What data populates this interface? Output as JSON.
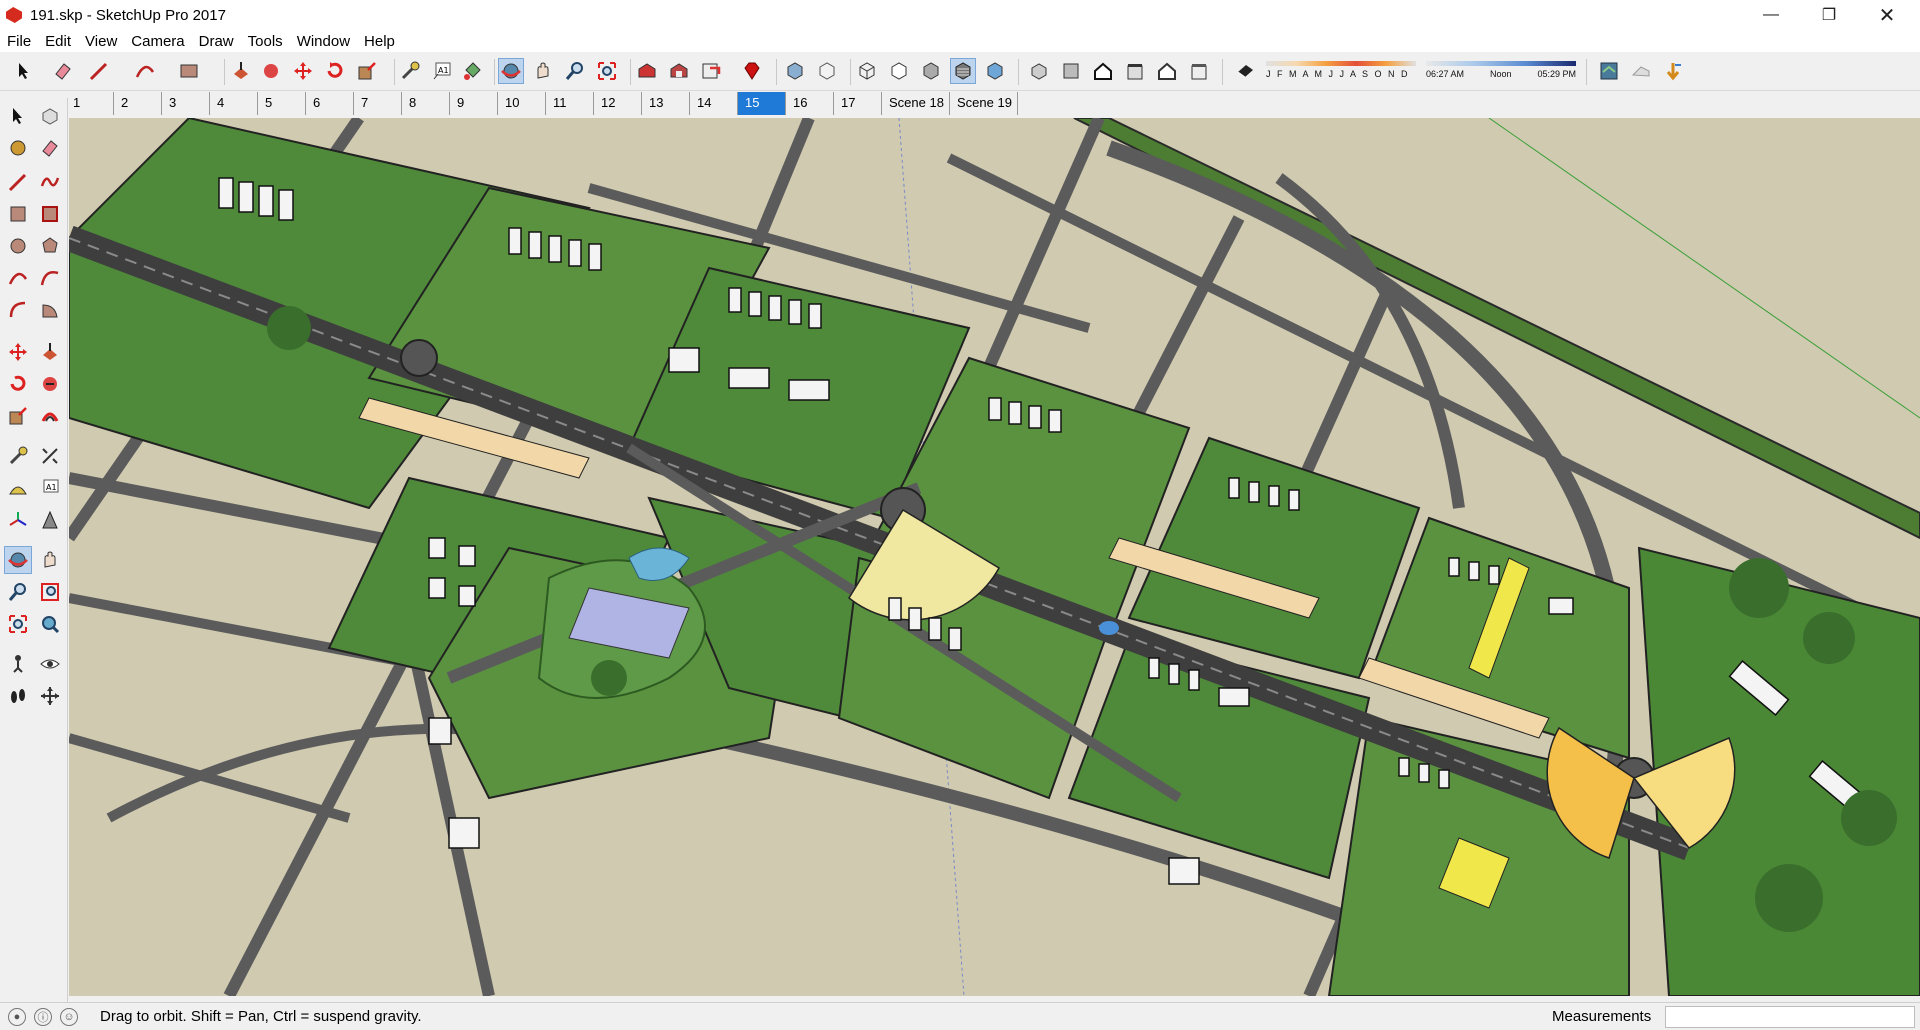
{
  "window": {
    "title": "191.skp - SketchUp Pro 2017"
  },
  "menu": [
    "File",
    "Edit",
    "View",
    "Camera",
    "Draw",
    "Tools",
    "Window",
    "Help"
  ],
  "scenes": {
    "tabs": [
      "1",
      "2",
      "3",
      "4",
      "5",
      "6",
      "7",
      "8",
      "9",
      "10",
      "11",
      "12",
      "13",
      "14",
      "15",
      "16",
      "17",
      "Scene 18",
      "Scene 19"
    ],
    "active": "15"
  },
  "shadow": {
    "months": "J F M A M J J A S O N D",
    "time_start": "06:27 AM",
    "time_mid": "Noon",
    "time_end": "05:29 PM"
  },
  "status": {
    "hint": "Drag to orbit. Shift = Pan, Ctrl = suspend gravity.",
    "measurements_label": "Measurements",
    "measurements_value": ""
  },
  "colors": {
    "accent": "#1e7ad6",
    "ground": "#d0cab0",
    "grass": "#4f8a3a",
    "road": "#5a5a5a"
  },
  "icons": {
    "toolbar": [
      "select-icon",
      "eraser-icon",
      "line-icon",
      "arc-icon",
      "rectangle-icon",
      "push-pull-icon",
      "follow-me-icon",
      "move-icon",
      "rotate-icon",
      "scale-icon",
      "tape-measure-icon",
      "text-icon",
      "paint-bucket-icon",
      "orbit-icon",
      "pan-icon",
      "zoom-icon",
      "zoom-extents-icon",
      "warehouse-icon",
      "extension-warehouse-icon",
      "layout-icon",
      "ruby-icon",
      "xray-icon",
      "back-edges-icon",
      "wireframe-icon",
      "hidden-line-icon",
      "shaded-icon",
      "shaded-textures-icon",
      "monochrome-icon",
      "iso-view-icon",
      "top-view-icon",
      "front-view-icon",
      "right-view-icon",
      "back-view-icon",
      "left-view-icon",
      "shadows-toggle-icon",
      "add-location-icon",
      "toggle-terrain-icon",
      "photo-textures-icon"
    ],
    "sidebar": [
      "select-icon",
      "make-component-icon",
      "paint-bucket-icon",
      "eraser-icon",
      "line-icon",
      "freehand-icon",
      "rectangle-icon",
      "rotated-rectangle-icon",
      "circle-icon",
      "polygon-icon",
      "arc-icon",
      "two-point-arc-icon",
      "three-point-arc-icon",
      "pie-icon",
      "move-icon",
      "push-pull-icon",
      "rotate-icon",
      "follow-me-icon",
      "scale-icon",
      "offset-icon",
      "tape-measure-icon",
      "dimension-icon",
      "protractor-icon",
      "text-icon",
      "axes-icon",
      "3d-text-icon",
      "orbit-icon",
      "pan-icon",
      "zoom-icon",
      "zoom-window-icon",
      "zoom-extents-icon",
      "previous-view-icon",
      "position-camera-icon",
      "look-around-icon",
      "walk-icon",
      "section-plane-icon"
    ]
  }
}
